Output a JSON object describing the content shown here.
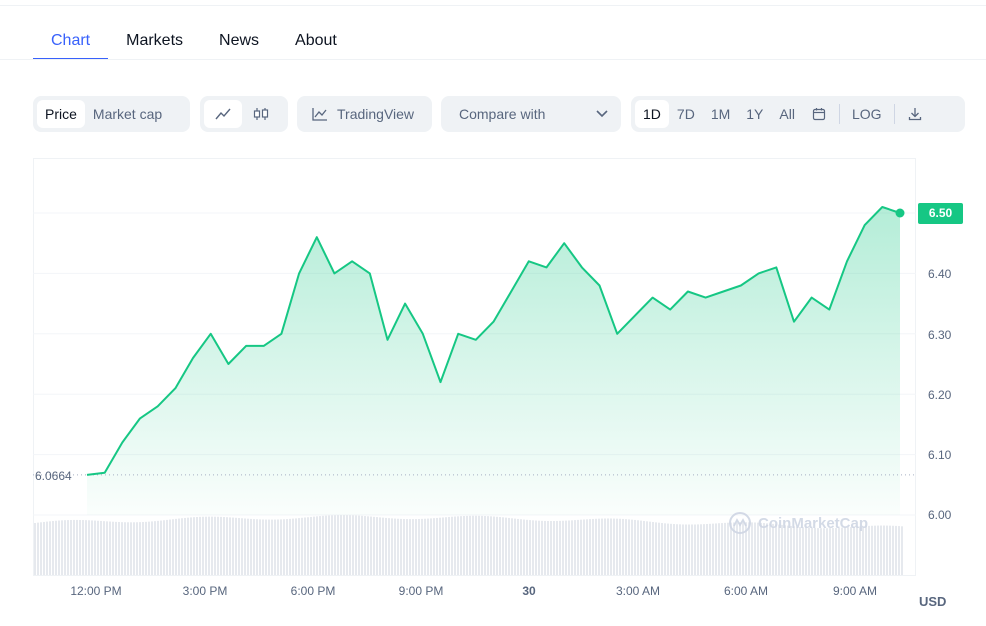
{
  "tabs": [
    "Chart",
    "Markets",
    "News",
    "About"
  ],
  "toolbar": {
    "price_label": "Price",
    "marketcap_label": "Market cap",
    "tradingview_label": "TradingView",
    "compare_label": "Compare with",
    "ranges": [
      "1D",
      "7D",
      "1M",
      "1Y",
      "All"
    ],
    "log_label": "LOG"
  },
  "colors": {
    "accent": "#3861fb",
    "up": "#16c784"
  },
  "chart_data": {
    "type": "area",
    "series": [
      {
        "x": [
          "11:10",
          "11:40",
          "12:10",
          "12:40",
          "13:10",
          "13:40",
          "14:10",
          "14:40",
          "15:10",
          "15:40",
          "16:10",
          "16:40",
          "17:10",
          "17:40",
          "18:10",
          "18:40",
          "19:10",
          "19:40",
          "20:10",
          "20:40",
          "21:10",
          "21:40",
          "22:10",
          "22:40",
          "23:10",
          "23:40",
          "00:10",
          "00:40",
          "01:10",
          "01:40",
          "02:10",
          "02:40",
          "03:10",
          "03:40",
          "04:10",
          "04:40",
          "05:10",
          "05:40",
          "06:10",
          "06:40",
          "07:10",
          "07:40",
          "08:10",
          "08:40",
          "09:10",
          "09:40",
          "10:05"
        ],
        "values": [
          6.0664,
          6.07,
          6.12,
          6.16,
          6.18,
          6.21,
          6.26,
          6.3,
          6.25,
          6.28,
          6.28,
          6.3,
          6.4,
          6.46,
          6.4,
          6.42,
          6.4,
          6.29,
          6.35,
          6.3,
          6.22,
          6.3,
          6.29,
          6.32,
          6.37,
          6.42,
          6.41,
          6.45,
          6.41,
          6.38,
          6.3,
          6.33,
          6.36,
          6.34,
          6.37,
          6.36,
          6.37,
          6.38,
          6.4,
          6.41,
          6.32,
          6.36,
          6.34,
          6.42,
          6.48,
          6.51,
          6.5
        ]
      }
    ],
    "current_price": "6.50",
    "baseline_label": "6.0664",
    "y_ticks": [
      "6.50",
      "6.40",
      "6.30",
      "6.20",
      "6.10",
      "6.00"
    ],
    "x_ticks": [
      "12:00 PM",
      "3:00 PM",
      "6:00 PM",
      "9:00 PM",
      "30",
      "3:00 AM",
      "6:00 AM",
      "9:00 AM"
    ],
    "currency": "USD",
    "ylim": [
      6.0,
      6.53
    ],
    "watermark": "CoinMarketCap"
  }
}
